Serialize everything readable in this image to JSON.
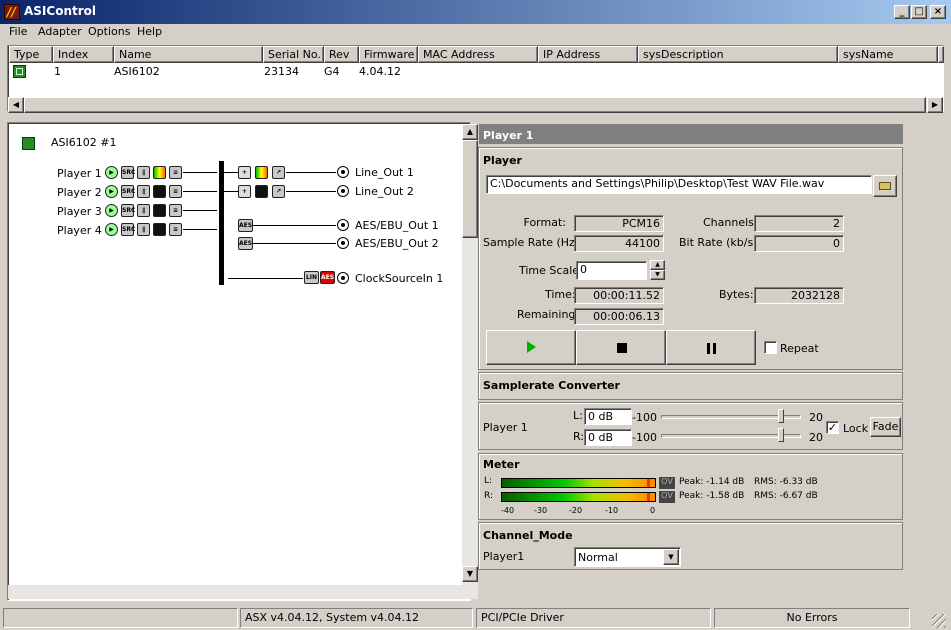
{
  "window": {
    "title": "ASIControl"
  },
  "menu": [
    "File",
    "Adapter",
    "Options",
    "Help"
  ],
  "adapters": {
    "columns": [
      "Type",
      "Index",
      "Name",
      "Serial No.",
      "Rev",
      "Firmware",
      "MAC Address",
      "IP Address",
      "sysDescription",
      "sysName",
      "s"
    ],
    "rows": [
      [
        "",
        "1",
        "ASI6102",
        "23134",
        "G4",
        "4.04.12",
        "",
        "",
        "",
        "",
        ""
      ]
    ]
  },
  "topology": {
    "adapter_label": "ASI6102 #1",
    "players": [
      "Player  1",
      "Player  2",
      "Player  3",
      "Player  4"
    ],
    "outputs": [
      "Line_Out  1",
      "Line_Out  2",
      "AES/EBU_Out  1",
      "AES/EBU_Out  2"
    ],
    "clock": "ClockSourceIn  1",
    "icon_labels": {
      "src": "SRC",
      "aes": "AES",
      "lin": "LIN",
      "ae": "AES"
    }
  },
  "panel": {
    "title": "Player  1"
  },
  "player": {
    "section": "Player",
    "file_path": "C:\\Documents and Settings\\Philip\\Desktop\\Test WAV File.wav",
    "format_label": "Format:",
    "format_value": "PCM16",
    "channels_label": "Channels:",
    "channels_value": "2",
    "rate_label": "Sample Rate (Hz):",
    "rate_value": "44100",
    "bitrate_label": "Bit Rate (kb/s):",
    "bitrate_value": "0",
    "timescale_label": "Time Scale:",
    "timescale_value": "0",
    "time_label": "Time:",
    "time_value": "00:00:11.52",
    "bytes_label": "Bytes:",
    "bytes_value": "2032128",
    "remaining_label": "Remaining:",
    "remaining_value": "00:00:06.13",
    "repeat_label": "Repeat"
  },
  "src": {
    "section": "Samplerate Converter",
    "name": "Player  1",
    "l_label": "L:",
    "l_value": "0 dB",
    "r_label": "R:",
    "r_value": "0 dB",
    "min": "-100",
    "max": "20",
    "l_level": 0.86,
    "r_level": 0.86,
    "lock_label": "Lock",
    "lock_checked": true,
    "fade_label": "Fade"
  },
  "meter": {
    "section": "Meter",
    "l_label": "L:",
    "r_label": "R:",
    "ov": "OV",
    "l_peak": "Peak: -1.14 dB",
    "l_rms": "RMS: -6.33 dB",
    "r_peak": "Peak: -1.58 dB",
    "r_rms": "RMS: -6.67 dB",
    "scale": [
      "-40",
      "-30",
      "-20",
      "-10",
      "0"
    ]
  },
  "channel_mode": {
    "section": "Channel_Mode",
    "label": "Player1",
    "value": "Normal"
  },
  "status": {
    "left": "",
    "version": "ASX v4.04.12, System v4.04.12",
    "driver": "PCI/PCIe Driver",
    "errors": "No Errors"
  },
  "colors": {
    "title_start": "#0a246a",
    "title_end": "#a6caf0",
    "play": "#00b000",
    "meter_peak": "#ff3000",
    "clock_red": "#e00000"
  }
}
